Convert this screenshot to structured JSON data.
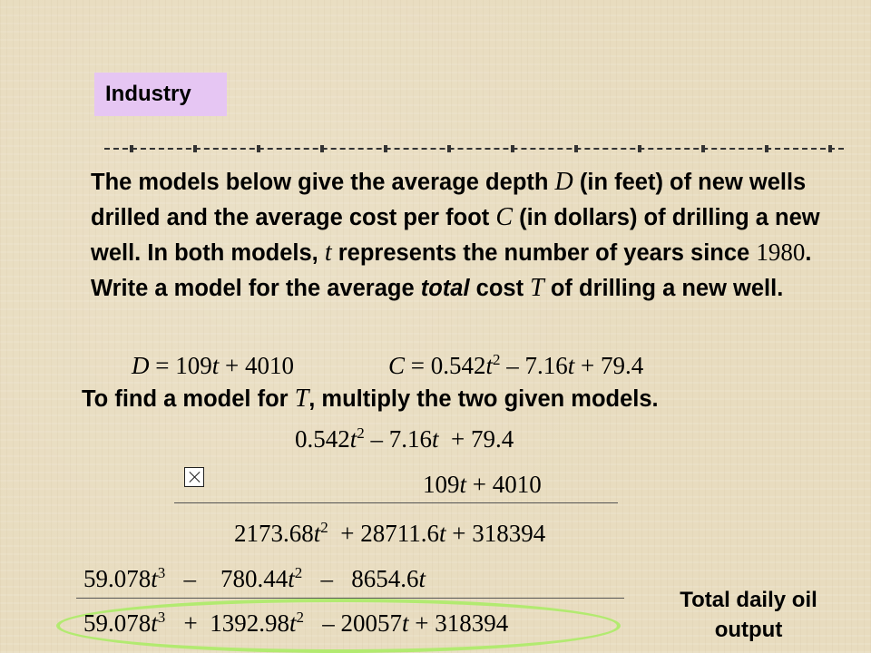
{
  "tag": "Industry",
  "paragraph": {
    "p1": "The models below give the average depth ",
    "v1": "D",
    "p2": " (in feet) of new wells drilled and the average cost per foot ",
    "v2": "C",
    "p3": " (in dollars) of drilling a new well. In both models, ",
    "v3": "t",
    "p4": " represents the number of years since ",
    "n1": "1980",
    "p5": ". Write a model for the average ",
    "emph": "total",
    "p6": " cost ",
    "v4": "T",
    "p7": " of drilling a new well."
  },
  "models": {
    "d_lhs": "D",
    "d_eq": " = 109",
    "d_t": "t",
    "d_tail": " + 4010",
    "c_lhs": "C",
    "c_eq": " = 0.542",
    "c_t": "t",
    "c_exp": "2",
    "c_tail1": " – 7.16",
    "c_t2": "t",
    "c_tail2": " + 79.4"
  },
  "instruction": {
    "a": "To find a model for ",
    "v": "T",
    "b": ", multiply the two given models."
  },
  "multiplication": {
    "row1": {
      "a": "0.542",
      "t1": "t",
      "e1": "2",
      "b": " – 7.16",
      "t2": "t",
      "c": "  + 79.4"
    },
    "row2": {
      "a": "109",
      "t1": "t",
      "b": " + 4010"
    },
    "row3": {
      "a": "2173.68",
      "t1": "t",
      "e1": "2",
      "b": "  + 28711.6",
      "t2": "t",
      "c": " + 318394"
    },
    "row4": {
      "a": "59.078",
      "t1": "t",
      "e1": "3",
      "b": "   –    780.44",
      "t2": "t",
      "e2": "2",
      "c": "   –   8654.6",
      "t3": "t"
    },
    "row5": {
      "a": "59.078",
      "t1": "t",
      "e1": "3",
      "b": "   +  1392.98",
      "t2": "t",
      "e2": "2",
      "c": "   – 20057",
      "t3": "t",
      "d": " + 318394"
    }
  },
  "note": {
    "line1": "Total daily oil",
    "line2": "output"
  },
  "colors": {
    "tag_bg": "#e6c6f3",
    "oval": "#b2ea70",
    "background": "#e8dcbf"
  }
}
